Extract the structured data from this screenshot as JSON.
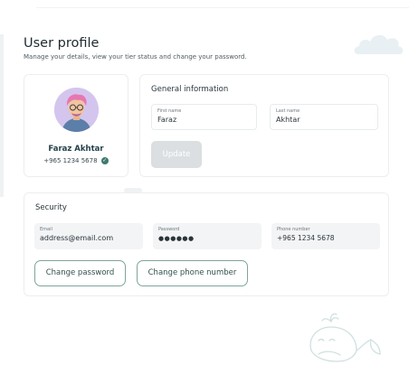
{
  "page": {
    "title": "User profile",
    "subtitle": "Manage your details, view your tier status and change your password."
  },
  "profile": {
    "name": "Faraz Akhtar",
    "phone": "+965 1234 5678",
    "verified_icon": "check-icon"
  },
  "general": {
    "heading": "General information",
    "first_name_label": "First name",
    "first_name": "Faraz",
    "last_name_label": "Last name",
    "last_name": "Akhtar",
    "update_label": "Update"
  },
  "security": {
    "heading": "Security",
    "email_label": "Email",
    "email": "address@email.com",
    "password_label": "Password",
    "password": "●●●●●●",
    "phone_label": "Phone number",
    "phone": "+965 1234 5678",
    "change_password_label": "Change password",
    "change_phone_label": "Change phone number"
  },
  "colors": {
    "accent": "#7ea59e",
    "name_text": "#24414a",
    "disabled_button": "#dcdfe1"
  }
}
